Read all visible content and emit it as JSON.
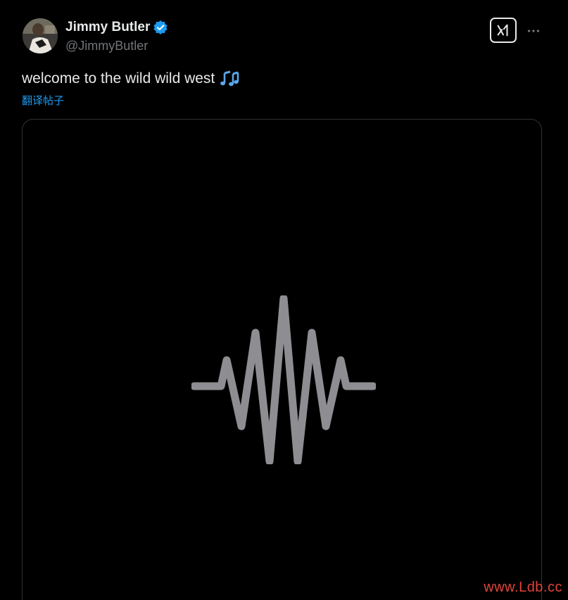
{
  "top_partial_text": "",
  "author": {
    "display_name": "Jimmy Butler",
    "handle": "@JimmyButler",
    "verified": true,
    "avatar_icon": "avatar-photo"
  },
  "header_actions": {
    "grok_icon": "grok-icon",
    "more_icon": "more-horizontal-icon"
  },
  "tweet": {
    "text": "welcome to the wild wild west",
    "emoji_icon": "musical-notes-icon",
    "translate_label": "翻译帖子"
  },
  "media": {
    "type": "audio",
    "icon": "audio-waveform-icon"
  },
  "watermark": "www.Ldb.cc",
  "colors": {
    "background": "#000000",
    "text_primary": "#e7e9ea",
    "text_secondary": "#71767b",
    "accent": "#1d9bf0",
    "waveform": "#8e8d92",
    "watermark": "#e0443a"
  }
}
